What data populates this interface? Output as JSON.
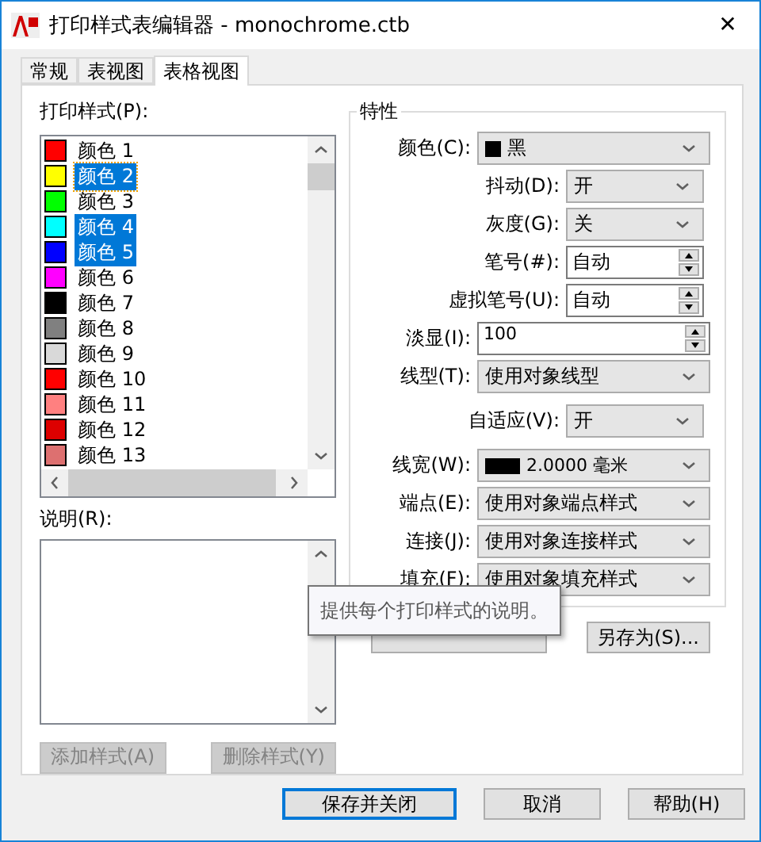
{
  "window": {
    "title": "打印样式表编辑器 - monochrome.ctb",
    "close": "✕"
  },
  "tabs": [
    {
      "label": "常规",
      "selected": false
    },
    {
      "label": "表视图",
      "selected": false
    },
    {
      "label": "表格视图",
      "selected": true
    }
  ],
  "styles": {
    "label": "打印样式(P):",
    "items": [
      {
        "name": "颜色 1",
        "color": "#ff0000",
        "selected": false,
        "focused": false
      },
      {
        "name": "颜色 2",
        "color": "#ffff00",
        "selected": true,
        "focused": true
      },
      {
        "name": "颜色 3",
        "color": "#00ff00",
        "selected": false,
        "focused": false
      },
      {
        "name": "颜色 4",
        "color": "#00ffff",
        "selected": true,
        "focused": false
      },
      {
        "name": "颜色 5",
        "color": "#0000ff",
        "selected": true,
        "focused": false
      },
      {
        "name": "颜色 6",
        "color": "#ff00ff",
        "selected": false,
        "focused": false
      },
      {
        "name": "颜色 7",
        "color": "#000000",
        "selected": false,
        "focused": false
      },
      {
        "name": "颜色 8",
        "color": "#808080",
        "selected": false,
        "focused": false
      },
      {
        "name": "颜色 9",
        "color": "#d9d9d9",
        "selected": false,
        "focused": false
      },
      {
        "name": "颜色 10",
        "color": "#ff0000",
        "selected": false,
        "focused": false
      },
      {
        "name": "颜色 11",
        "color": "#ff8080",
        "selected": false,
        "focused": false
      },
      {
        "name": "颜色 12",
        "color": "#dd0000",
        "selected": false,
        "focused": false
      },
      {
        "name": "颜色 13",
        "color": "#dd7070",
        "selected": false,
        "focused": false
      }
    ]
  },
  "description": {
    "label": "说明(R):"
  },
  "style_buttons": [
    {
      "label": "添加样式(A)",
      "disabled": true
    },
    {
      "label": "删除样式(Y)",
      "disabled": true
    }
  ],
  "properties": {
    "title": "特性",
    "rows": [
      {
        "kind": "color-select",
        "label": "颜色(C):",
        "value": "黑"
      },
      {
        "kind": "narrow-select",
        "label": "抖动(D):",
        "value": "开"
      },
      {
        "kind": "narrow-select",
        "label": "灰度(G):",
        "value": "关"
      },
      {
        "kind": "narrow-spin",
        "label": "笔号(#):",
        "value": "自动"
      },
      {
        "kind": "narrow-spin",
        "label": "虚拟笔号(U):",
        "value": "自动"
      },
      {
        "kind": "wide-spin",
        "label": "淡显(I):",
        "value": "100"
      },
      {
        "kind": "wide-select",
        "label": "线型(T):",
        "value": "使用对象线型"
      },
      {
        "kind": "narrow-select",
        "label": "自适应(V):",
        "value": "开"
      },
      {
        "kind": "weight-select",
        "label": "线宽(W):",
        "value": "2.0000 毫米"
      },
      {
        "kind": "wide-select",
        "label": "端点(E):",
        "value": "使用对象端点样式"
      },
      {
        "kind": "wide-select",
        "label": "连接(J):",
        "value": "使用对象连接样式"
      },
      {
        "kind": "wide-select",
        "label": "填充(F):",
        "value": "使用对象填充样式"
      }
    ]
  },
  "save_as_button": "另存为(S)...",
  "tooltip": "提供每个打印样式的说明。",
  "footer_buttons": [
    {
      "label": "保存并关闭",
      "focused": true
    },
    {
      "label": "取消",
      "focused": false
    },
    {
      "label": "帮助(H)",
      "focused": false
    }
  ]
}
